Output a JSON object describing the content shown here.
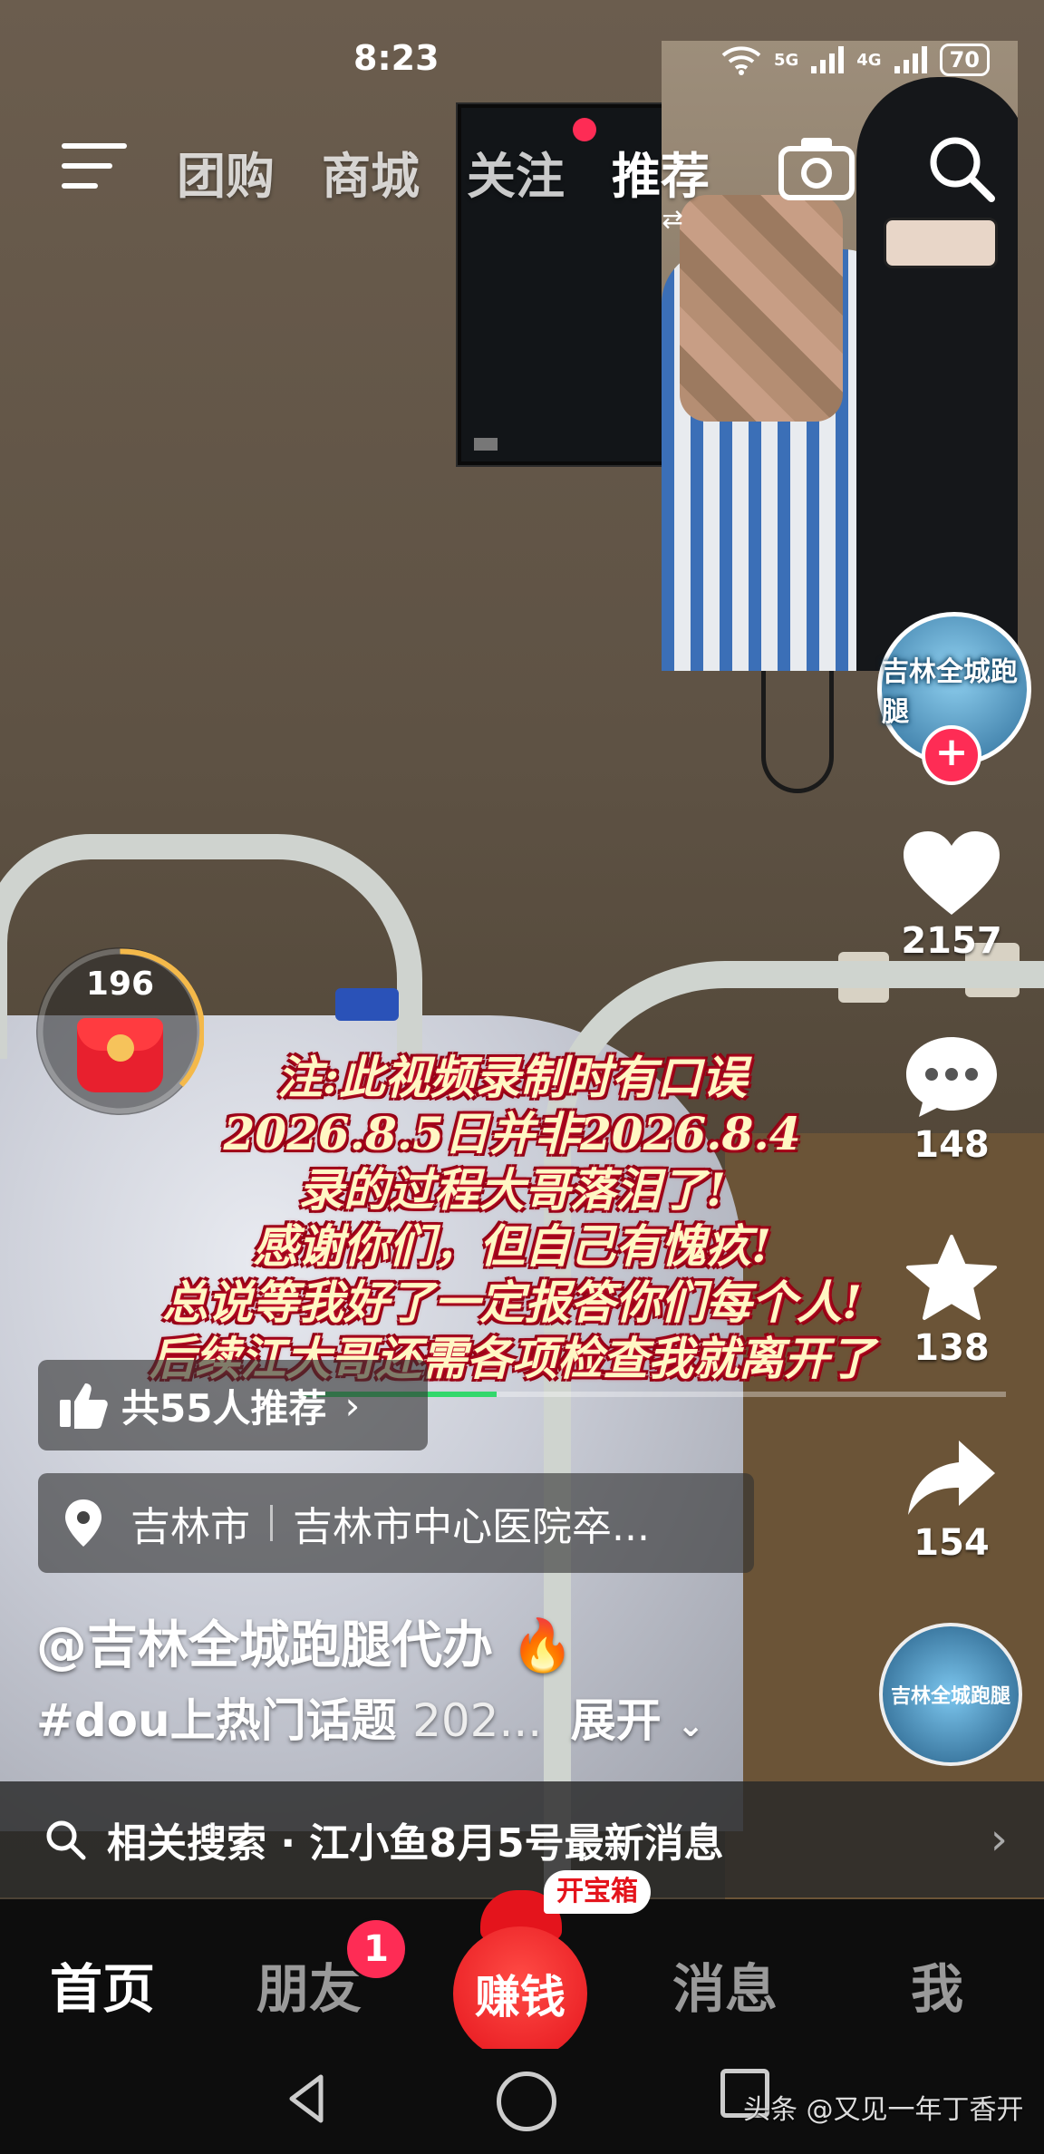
{
  "status_bar": {
    "time": "8:23",
    "signal_1": "5G",
    "signal_2": "4G",
    "battery": "70"
  },
  "top_nav": {
    "tabs": [
      {
        "label": "团购"
      },
      {
        "label": "商城"
      },
      {
        "label": "关注"
      },
      {
        "label": "推荐"
      }
    ],
    "active_tab": "推荐",
    "icons": [
      "menu-icon",
      "camera-icon",
      "search-icon"
    ]
  },
  "red_packet": {
    "count": "196"
  },
  "caption": {
    "lines": [
      "注:此视频录制时有口误",
      "2026.8.5日并非2026.8.4",
      "录的过程大哥落泪了!",
      "感谢你们，但自己有愧疚!",
      "总说等我好了一定报答你们每个人!",
      "后续江大哥还需各项检查我就离开了"
    ]
  },
  "side_actions": {
    "avatar_text": "吉林全城跑腿",
    "likes": "2157",
    "comments": "148",
    "favorites": "138",
    "shares": "154",
    "music_text": "吉林全城跑腿"
  },
  "recommend": {
    "label": "共55人推荐"
  },
  "location": {
    "city": "吉林市",
    "place": "吉林市中心医院卒..."
  },
  "author": {
    "handle": "@吉林全城跑腿代办"
  },
  "description": {
    "hashtag": "#dou上热门话题",
    "text": "202...",
    "expand": "展开"
  },
  "related_search": {
    "label": "相关搜索 · 江小鱼8月5号最新消息"
  },
  "bottom_tabs": {
    "home": "首页",
    "friends": "朋友",
    "friends_badge": "1",
    "earn": "赚钱",
    "earn_tag": "开宝箱",
    "messages": "消息",
    "me": "我"
  },
  "watermark": "头条 @又见一年丁香开",
  "colors": {
    "accent": "#fe2c55",
    "caption_text": "#fff7c4",
    "caption_outline": "#c8102e",
    "progress": "#33d86c"
  }
}
